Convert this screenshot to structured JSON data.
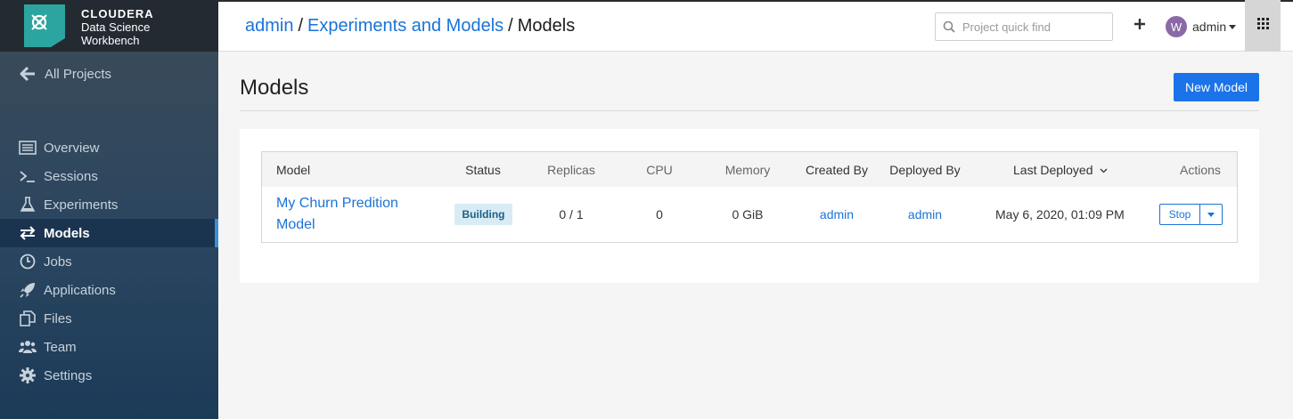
{
  "brand": {
    "line1": "CLOUDERA",
    "line2": "Data Science",
    "line3": "Workbench",
    "logo_icon": "cloudera-logo-icon",
    "logo_color": "#2ca5a0"
  },
  "sidebar": {
    "back_label": "All Projects",
    "items": [
      {
        "label": "Overview",
        "icon": "list-icon",
        "active": false
      },
      {
        "label": "Sessions",
        "icon": "terminal-icon",
        "active": false
      },
      {
        "label": "Experiments",
        "icon": "flask-icon",
        "active": false
      },
      {
        "label": "Models",
        "icon": "arrows-exchange-icon",
        "active": true
      },
      {
        "label": "Jobs",
        "icon": "clock-icon",
        "active": false
      },
      {
        "label": "Applications",
        "icon": "rocket-icon",
        "active": false
      },
      {
        "label": "Files",
        "icon": "files-icon",
        "active": false
      },
      {
        "label": "Team",
        "icon": "users-icon",
        "active": false
      },
      {
        "label": "Settings",
        "icon": "gear-icon",
        "active": false
      }
    ]
  },
  "header": {
    "breadcrumb": [
      "admin",
      "Experiments and Models",
      "Models"
    ],
    "separator": "/",
    "search_placeholder": "Project quick find",
    "user_initial": "W",
    "user_name": "admin"
  },
  "main": {
    "title": "Models",
    "new_model_label": "New Model",
    "table": {
      "columns": [
        "Model",
        "Status",
        "Replicas",
        "CPU",
        "Memory",
        "Created By",
        "Deployed By",
        "Last Deployed",
        "Actions"
      ],
      "rows": [
        {
          "model": "My Churn Predition Model",
          "status": "Building",
          "replicas": "0 / 1",
          "cpu": "0",
          "memory": "0 GiB",
          "created_by": "admin",
          "deployed_by": "admin",
          "last_deployed": "May 6, 2020, 01:09 PM",
          "action_label": "Stop"
        }
      ]
    }
  },
  "colors": {
    "accent": "#1a73e8",
    "link": "#1a73d8",
    "status_building_bg": "#d8ecf5",
    "sidebar_active_bar": "#3a8fd8"
  }
}
